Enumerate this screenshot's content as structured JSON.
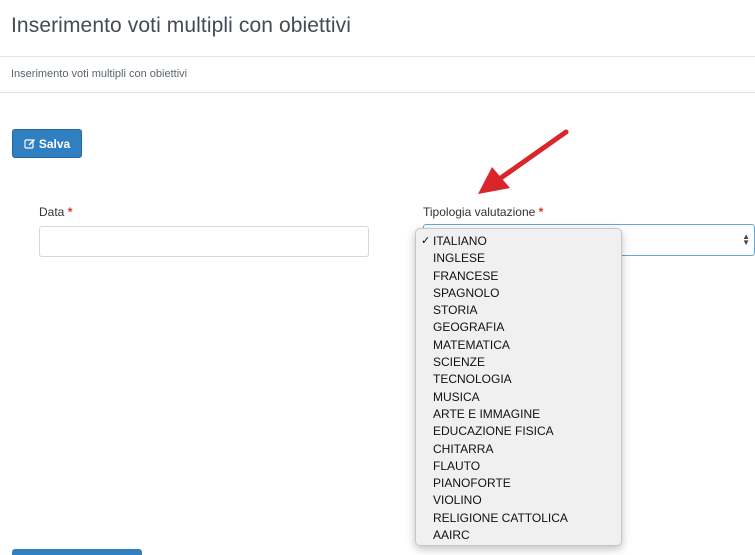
{
  "header": {
    "title": "Inserimento voti multipli con obiettivi"
  },
  "breadcrumb": {
    "text": "Inserimento voti multipli con obiettivi"
  },
  "toolbar": {
    "save_label": "Salva",
    "save_icon": "edit-icon"
  },
  "form": {
    "date": {
      "label": "Data",
      "required_mark": "*",
      "value": ""
    },
    "tipologia": {
      "label": "Tipologia valutazione",
      "required_mark": "*",
      "selected": "ITALIANO",
      "check_mark": "✓",
      "options": [
        "ITALIANO",
        "INGLESE",
        "FRANCESE",
        "SPAGNOLO",
        "STORIA",
        "GEOGRAFIA",
        "MATEMATICA",
        "SCIENZE",
        "TECNOLOGIA",
        "MUSICA",
        "ARTE E IMMAGINE",
        "EDUCAZIONE FISICA",
        "CHITARRA",
        "FLAUTO",
        "PIANOFORTE",
        "VIOLINO",
        "RELIGIONE CATTOLICA",
        "AAIRC"
      ]
    }
  },
  "colors": {
    "primary_button": "#2f7fc1",
    "required_star": "#d9342b",
    "annotation_arrow": "#d9262b"
  }
}
